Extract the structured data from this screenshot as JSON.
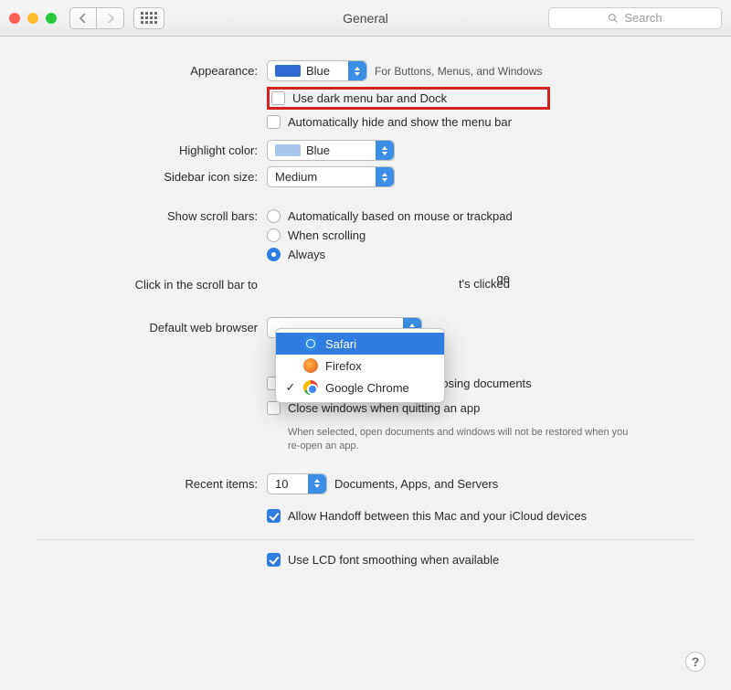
{
  "window": {
    "title": "General"
  },
  "search": {
    "placeholder": "Search"
  },
  "labels": {
    "appearance": "Appearance:",
    "highlight": "Highlight color:",
    "sidebar": "Sidebar icon size:",
    "scrollbars": "Show scroll bars:",
    "click_scroll": "Click in the scroll bar to",
    "default_browser": "Default web browser",
    "recent": "Recent items:"
  },
  "appearance": {
    "value": "Blue",
    "note": "For Buttons, Menus, and Windows",
    "dark_label": "Use dark menu bar and Dock",
    "autohide_label": "Automatically hide and show the menu bar"
  },
  "highlight": {
    "value": "Blue"
  },
  "sidebar": {
    "value": "Medium"
  },
  "scrollbars": {
    "opt1": "Automatically based on mouse or trackpad",
    "opt2": "When scrolling",
    "opt3": "Always"
  },
  "click_scroll": {
    "opt1_tail": "ge",
    "opt2_tail": "t's clicked"
  },
  "browser_popup": {
    "items": [
      {
        "name": "Safari",
        "selected": true,
        "checked": false
      },
      {
        "name": "Firefox",
        "selected": false,
        "checked": false
      },
      {
        "name": "Google Chrome",
        "selected": false,
        "checked": true
      }
    ]
  },
  "documents": {
    "ask_label": "Ask to keep changes when closing documents",
    "close_label": "Close windows when quitting an app",
    "close_note": "When selected, open documents and windows will not be restored when you re-open an app."
  },
  "recent": {
    "value": "10",
    "suffix": "Documents, Apps, and Servers"
  },
  "handoff_label": "Allow Handoff between this Mac and your iCloud devices",
  "lcd_label": "Use LCD font smoothing when available",
  "help": "?"
}
